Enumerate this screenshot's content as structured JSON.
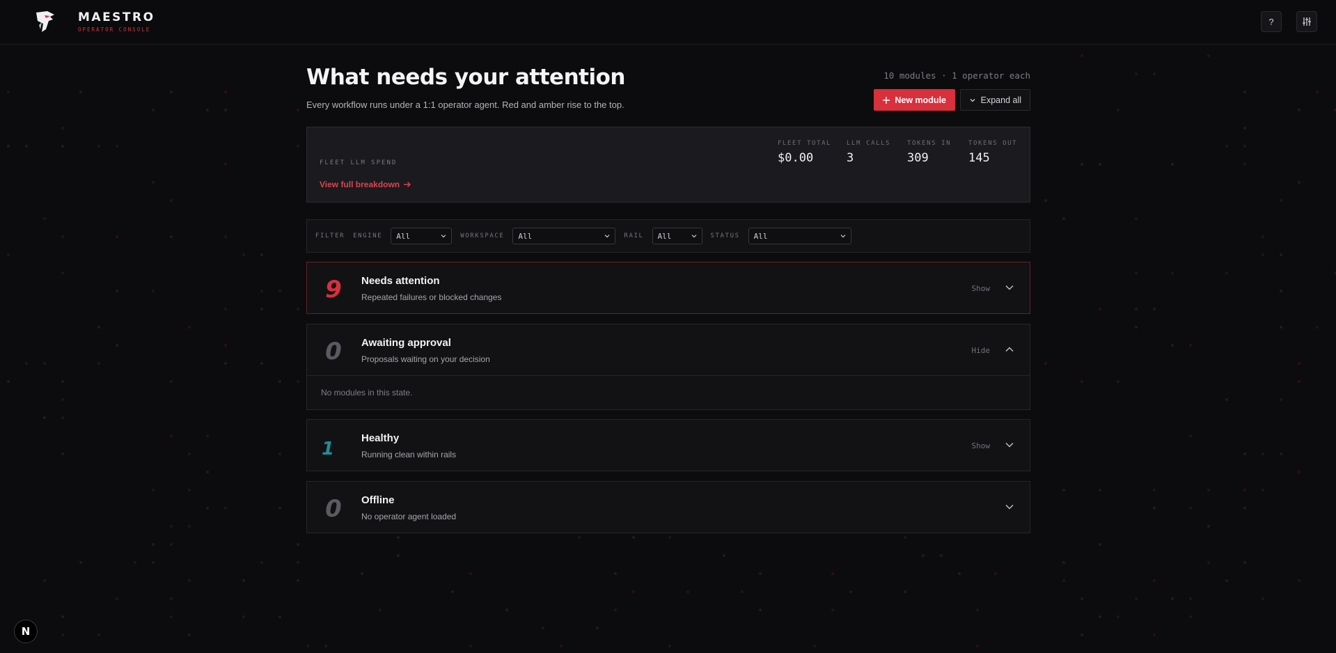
{
  "header": {
    "brand": "MAESTRO",
    "subtitle": "OPERATOR CONSOLE",
    "help_label": "?",
    "accent_color": "#d8303c"
  },
  "page": {
    "title": "What needs your attention",
    "subtitle": "Every workflow runs under a 1:1 operator agent. Red and amber rise to the top.",
    "module_count": "10 modules · 1 operator each",
    "new_module_label": "New module",
    "expand_all_label": "Expand all"
  },
  "spend": {
    "label": "FLEET LLM SPEND",
    "link": "View full breakdown",
    "stats": [
      {
        "label": "FLEET TOTAL",
        "value": "$0.00"
      },
      {
        "label": "LLM CALLS",
        "value": "3"
      },
      {
        "label": "TOKENS IN",
        "value": "309"
      },
      {
        "label": "TOKENS OUT",
        "value": "145"
      }
    ]
  },
  "filter": {
    "label": "FILTER",
    "fields": [
      {
        "label": "ENGINE",
        "value": "All"
      },
      {
        "label": "WORKSPACE",
        "value": "All"
      },
      {
        "label": "RAIL",
        "value": "All"
      },
      {
        "label": "STATUS",
        "value": "All"
      }
    ]
  },
  "groups": [
    {
      "count": 9,
      "title": "Needs attention",
      "desc": "Repeated failures or blocked changes",
      "toggle": "Show",
      "color": "#d8303c"
    },
    {
      "count": 0,
      "title": "Awaiting approval",
      "desc": "Proposals waiting on your decision",
      "toggle": "Hide",
      "empty": "No modules in this state.",
      "color": "#5a5a60"
    },
    {
      "count": 1,
      "title": "Healthy",
      "desc": "Running clean within rails",
      "toggle": "Show",
      "color": "#1f8f94"
    },
    {
      "count": 0,
      "title": "Offline",
      "desc": "No operator agent loaded",
      "toggle": "",
      "color": "#5a5a60"
    }
  ],
  "dev_badge": "N"
}
